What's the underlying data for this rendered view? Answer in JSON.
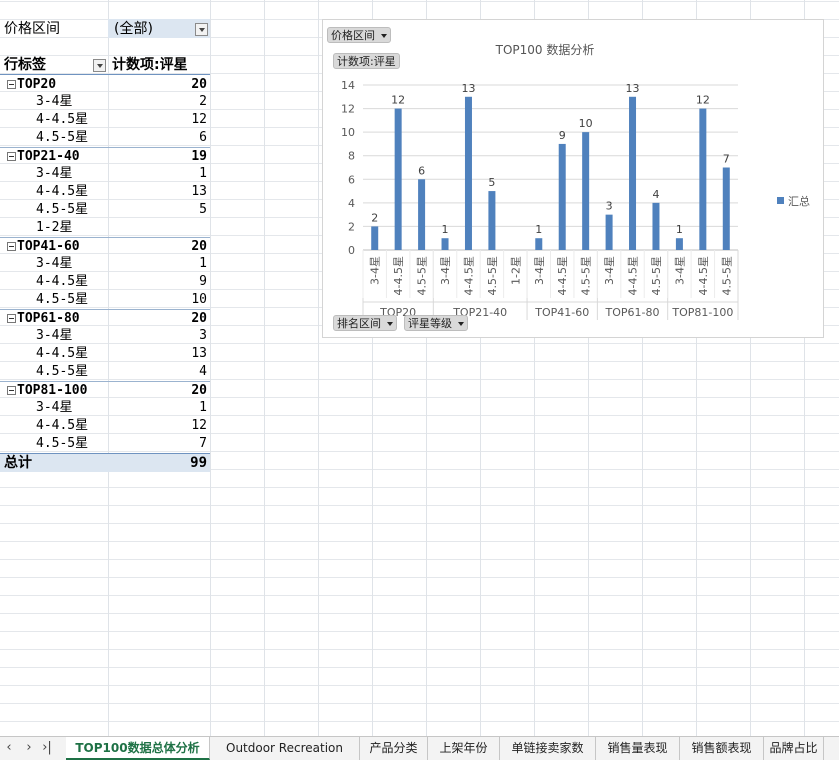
{
  "pivot": {
    "filter_label": "价格区间",
    "filter_value": "(全部)",
    "row_header": "行标签",
    "value_header": "计数项:评星",
    "groups": [
      {
        "label": "TOP20",
        "total": "20",
        "items": [
          {
            "label": "3-4星",
            "value": "2"
          },
          {
            "label": "4-4.5星",
            "value": "12"
          },
          {
            "label": "4.5-5星",
            "value": "6"
          }
        ]
      },
      {
        "label": "TOP21-40",
        "total": "19",
        "items": [
          {
            "label": "3-4星",
            "value": "1"
          },
          {
            "label": "4-4.5星",
            "value": "13"
          },
          {
            "label": "4.5-5星",
            "value": "5"
          },
          {
            "label": "1-2星",
            "value": ""
          }
        ]
      },
      {
        "label": "TOP41-60",
        "total": "20",
        "items": [
          {
            "label": "3-4星",
            "value": "1"
          },
          {
            "label": "4-4.5星",
            "value": "9"
          },
          {
            "label": "4.5-5星",
            "value": "10"
          }
        ]
      },
      {
        "label": "TOP61-80",
        "total": "20",
        "items": [
          {
            "label": "3-4星",
            "value": "3"
          },
          {
            "label": "4-4.5星",
            "value": "13"
          },
          {
            "label": "4.5-5星",
            "value": "4"
          }
        ]
      },
      {
        "label": "TOP81-100",
        "total": "20",
        "items": [
          {
            "label": "3-4星",
            "value": "1"
          },
          {
            "label": "4-4.5星",
            "value": "12"
          },
          {
            "label": "4.5-5星",
            "value": "7"
          }
        ]
      }
    ],
    "grand_total_label": "总计",
    "grand_total_value": "99"
  },
  "chart_buttons": {
    "price": "价格区间",
    "count": "计数项:评星",
    "rank": "排名区间",
    "rating": "评星等级"
  },
  "chart_data": {
    "type": "bar",
    "title": "TOP100 数据分析",
    "legend": [
      "汇总"
    ],
    "legend_position": "right",
    "ylim": [
      0,
      14
    ],
    "yticks": [
      0,
      2,
      4,
      6,
      8,
      10,
      12,
      14
    ],
    "grid": true,
    "bar_color": "#4f81bd",
    "groups": [
      {
        "name": "TOP20",
        "categories": [
          "3-4星",
          "4-4.5星",
          "4.5-5星"
        ],
        "values": [
          2,
          12,
          6
        ]
      },
      {
        "name": "TOP21-40",
        "categories": [
          "3-4星",
          "4-4.5星",
          "4.5-5星",
          "1-2星"
        ],
        "values": [
          1,
          13,
          5,
          null
        ]
      },
      {
        "name": "TOP41-60",
        "categories": [
          "3-4星",
          "4-4.5星",
          "4.5-5星"
        ],
        "values": [
          1,
          9,
          10
        ]
      },
      {
        "name": "TOP61-80",
        "categories": [
          "3-4星",
          "4-4.5星",
          "4.5-5星"
        ],
        "values": [
          3,
          13,
          4
        ]
      },
      {
        "name": "TOP81-100",
        "categories": [
          "3-4星",
          "4-4.5星",
          "4.5-5星"
        ],
        "values": [
          1,
          12,
          7
        ]
      }
    ]
  },
  "tabs": [
    "TOP100数据总体分析",
    "Outdoor Recreation",
    "产品分类",
    "上架年份",
    "单链接卖家数",
    "销售量表现",
    "销售额表现",
    "品牌占比"
  ],
  "active_tab": "TOP100数据总体分析",
  "nav": {
    "prev": "‹",
    "next": "›",
    "last": "›|"
  }
}
